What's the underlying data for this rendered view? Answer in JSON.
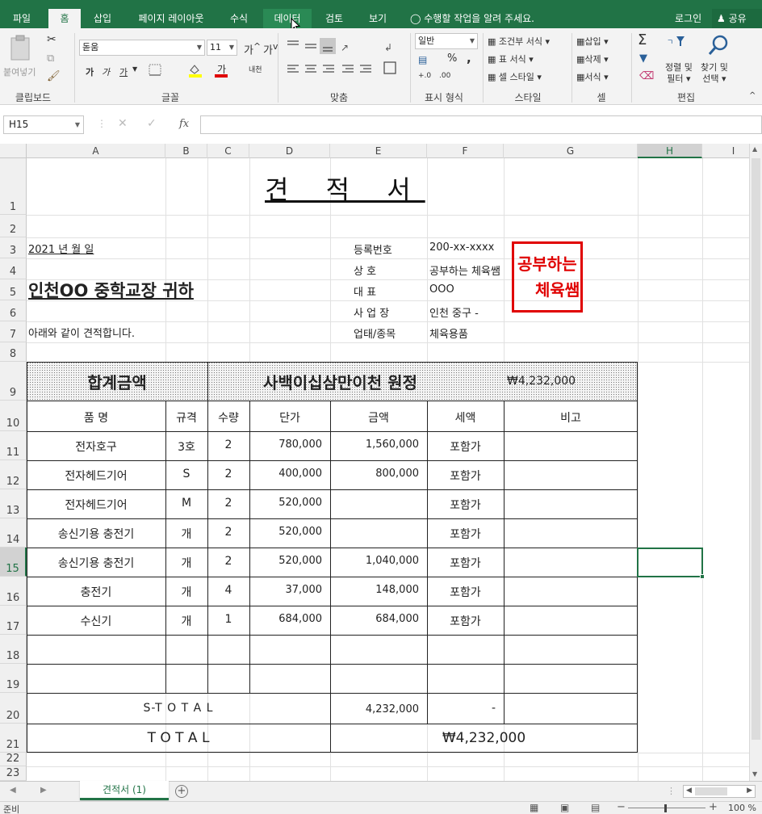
{
  "ribbon_tabs": [
    "파일",
    "홈",
    "삽입",
    "페이지 레이아웃",
    "수식",
    "데이터",
    "검토",
    "보기"
  ],
  "active_tab": "홈",
  "tell_me": "수행할 작업을 알려 주세요.",
  "login": "로그인",
  "share": "공유",
  "clipboard": {
    "paste": "붙여넣기",
    "label": "클립보드"
  },
  "font": {
    "name": "돋움",
    "size": "11",
    "bold": "가",
    "italic": "가",
    "underline": "가",
    "grow": "가",
    "shrink": "가",
    "label": "글꼴",
    "phonetic": "내천"
  },
  "alignment": {
    "label": "맞춤"
  },
  "number": {
    "format": "일반",
    "percent": "%",
    "comma": ",",
    "label": "표시 형식"
  },
  "styles": {
    "conditional": "조건부 서식",
    "table": "표 서식",
    "cell": "셀 스타일",
    "label": "스타일"
  },
  "cells": {
    "insert": "삽입",
    "delete": "삭제",
    "format": "서식",
    "label": "셀"
  },
  "editing": {
    "sort": "정렬 및",
    "filter": "필터",
    "find": "찾기 및",
    "select": "선택",
    "label": "편집"
  },
  "formula_bar": {
    "name_box": "H15",
    "fx": "fx",
    "value": ""
  },
  "columns": [
    "A",
    "B",
    "C",
    "D",
    "E",
    "F",
    "G",
    "H",
    "I"
  ],
  "selected_column": "H",
  "rows": [
    "1",
    "2",
    "3",
    "4",
    "5",
    "6",
    "7",
    "8",
    "9",
    "10",
    "11",
    "12",
    "13",
    "14",
    "15",
    "16",
    "17",
    "18",
    "19",
    "20",
    "21",
    "22",
    "23"
  ],
  "selected_row": "15",
  "sheet": {
    "title": "견 적 서",
    "date": "2021 년      월      일",
    "recipient": "인천OO 중학교장    귀하",
    "intro": "아래와 같이 견적합니다.",
    "info_labels": [
      "등록번호",
      "상      호",
      "대      표",
      "사  업  장",
      "업태/종목"
    ],
    "info_values": [
      "200-xx-xxxx",
      "공부하는 체육쌤",
      "OOO",
      "인천 중구 -",
      "체육용품"
    ],
    "stamp_line1": "공부하는",
    "stamp_line2": "체육쌤",
    "total_label": "합계금액",
    "total_words": "사백이십삼만이천  원정",
    "total_amount": "₩4,232,000",
    "headers": [
      "품   명",
      "규격",
      "수량",
      "단가",
      "금액",
      "세액",
      "비고"
    ],
    "items": [
      {
        "name": "전자호구",
        "spec": "3호",
        "qty": "2",
        "price": "780,000",
        "amount": "1,560,000",
        "tax": "포함가",
        "note": ""
      },
      {
        "name": "전자헤드기어",
        "spec": "S",
        "qty": "2",
        "price": "400,000",
        "amount": "800,000",
        "tax": "포함가",
        "note": ""
      },
      {
        "name": "전자헤드기어",
        "spec": "M",
        "qty": "2",
        "price": "520,000",
        "amount": "",
        "tax": "포함가",
        "note": ""
      },
      {
        "name": "송신기용 충전기",
        "spec": "개",
        "qty": "2",
        "price": "520,000",
        "amount": "",
        "tax": "포함가",
        "note": ""
      },
      {
        "name": "송신기용 충전기",
        "spec": "개",
        "qty": "2",
        "price": "520,000",
        "amount": "1,040,000",
        "tax": "포함가",
        "note": ""
      },
      {
        "name": "충전기",
        "spec": "개",
        "qty": "4",
        "price": "37,000",
        "amount": "148,000",
        "tax": "포함가",
        "note": ""
      },
      {
        "name": "수신기",
        "spec": "개",
        "qty": "1",
        "price": "684,000",
        "amount": "684,000",
        "tax": "포함가",
        "note": ""
      }
    ],
    "subtotal_label": "S-T O T A L",
    "subtotal_amount": "4,232,000",
    "subtotal_tax": "-",
    "grand_label": "T   O   T   A   L",
    "grand_amount": "₩4,232,000"
  },
  "sheet_tabs": [
    "견적서 (1)"
  ],
  "status": {
    "ready": "준비",
    "zoom": "100 %"
  },
  "colors": {
    "excel_green": "#217346",
    "stamp_red": "#e00000"
  }
}
